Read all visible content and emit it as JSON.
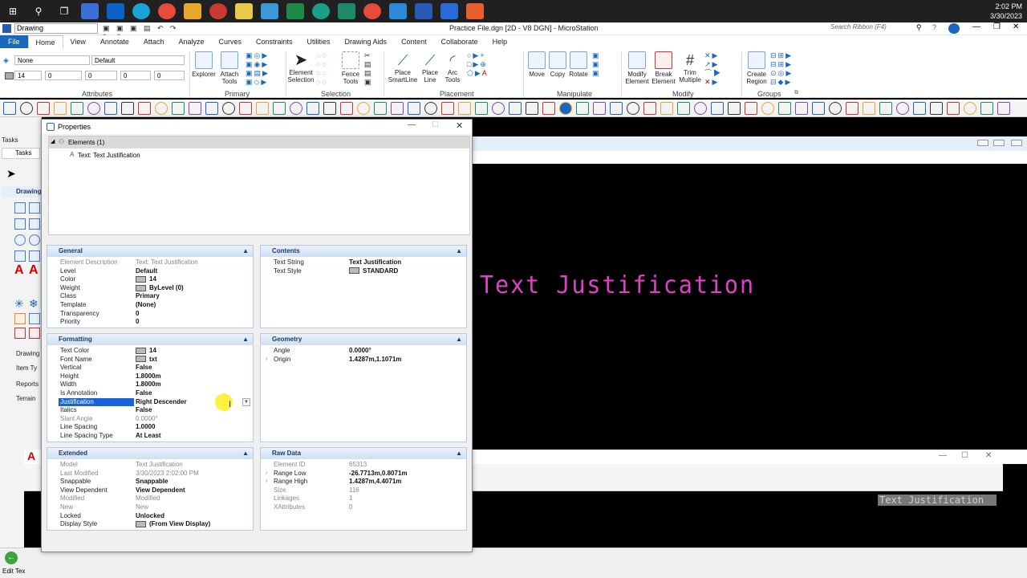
{
  "taskbar": {
    "time": "2:02 PM",
    "date": "3/30/2023"
  },
  "titlebar": {
    "workspace": "Drawing",
    "title": "Practice File.dgn [2D - V8 DGN] - MicroStation",
    "search_placeholder": "Search Ribbon (F4)"
  },
  "menu": [
    "File",
    "Home",
    "View",
    "Annotate",
    "Attach",
    "Analyze",
    "Curves",
    "Constraints",
    "Utilities",
    "Drawing Aids",
    "Content",
    "Collaborate",
    "Help"
  ],
  "ribbon": {
    "attributes": {
      "level": "None",
      "style": "Default",
      "color": "14",
      "weight": "0",
      "line": "0",
      "a": "0",
      "b": "0",
      "c": "0",
      "label": "Attributes"
    },
    "primary": {
      "explorer": "Explorer",
      "attach_tools": "Attach Tools",
      "label": "Primary"
    },
    "selection": {
      "element_selection": "Element Selection",
      "fence_tools": "Fence Tools",
      "label": "Selection"
    },
    "placement": {
      "place_smartline": "Place SmartLine",
      "place_line": "Place Line",
      "arc_tools": "Arc Tools",
      "label": "Placement"
    },
    "manipulate": {
      "move": "Move",
      "copy": "Copy",
      "rotate": "Rotate",
      "label": "Manipulate"
    },
    "modify": {
      "modify_element": "Modify Element",
      "break_element": "Break Element",
      "trim_multiple": "Trim Multiple",
      "label": "Modify"
    },
    "groups": {
      "create_region": "Create Region",
      "label": "Groups"
    }
  },
  "leftpanel": {
    "tasks": "Tasks",
    "tasks_tab": "Tasks",
    "drawing": "Drawing",
    "drawing2": "Drawing",
    "item_types": "Item Ty",
    "reports": "Reports",
    "terrain": "Terrain",
    "edit_text": "Edit Tex"
  },
  "canvas": {
    "text": "Text Justification"
  },
  "view2": {
    "text": "Text Justification"
  },
  "properties": {
    "title": "Properties",
    "tree": {
      "root": "Elements (1)",
      "child": "Text: Text Justification"
    },
    "general": {
      "title": "General",
      "rows": [
        {
          "k": "Element Description",
          "v": "Text: Text Justification",
          "dim": true
        },
        {
          "k": "Level",
          "v": "Default"
        },
        {
          "k": "Color",
          "v": "14",
          "swatch": true
        },
        {
          "k": "Weight",
          "v": "ByLevel (0)",
          "swatch": true
        },
        {
          "k": "Class",
          "v": "Primary"
        },
        {
          "k": "Template",
          "v": "(None)"
        },
        {
          "k": "Transparency",
          "v": "0"
        },
        {
          "k": "Priority",
          "v": "0"
        }
      ]
    },
    "contents": {
      "title": "Contents",
      "rows": [
        {
          "k": "Text String",
          "v": "Text Justification"
        },
        {
          "k": "Text Style",
          "v": "STANDARD",
          "swatch": true
        }
      ]
    },
    "formatting": {
      "title": "Formatting",
      "rows": [
        {
          "k": "Text Color",
          "v": "14",
          "swatch": true
        },
        {
          "k": "Font Name",
          "v": "txt",
          "swatch": true
        },
        {
          "k": "Vertical",
          "v": "False"
        },
        {
          "k": "Height",
          "v": "1.8000m"
        },
        {
          "k": "Width",
          "v": "1.8000m"
        },
        {
          "k": "Is Annotation",
          "v": "False"
        },
        {
          "k": "Justification",
          "v": "Right Descender",
          "hl": true
        },
        {
          "k": "Italics",
          "v": "False"
        },
        {
          "k": "Slant Angle",
          "v": "0.0000°",
          "dim": true
        },
        {
          "k": "Line Spacing",
          "v": "1.0000"
        },
        {
          "k": "Line Spacing Type",
          "v": "At Least"
        }
      ]
    },
    "geometry": {
      "title": "Geometry",
      "rows": [
        {
          "k": "Angle",
          "v": "0.0000°"
        },
        {
          "k": "Origin",
          "v": "1.4287m,1.1071m",
          "expand": true
        }
      ]
    },
    "extended": {
      "title": "Extended",
      "rows": [
        {
          "k": "Model",
          "v": "Text Justification",
          "dim": true
        },
        {
          "k": "Last Modified",
          "v": "3/30/2023 2:02:00 PM",
          "dim": true
        },
        {
          "k": "Snappable",
          "v": "Snappable"
        },
        {
          "k": "View Dependent",
          "v": "View Dependent"
        },
        {
          "k": "Modified",
          "v": "Modified",
          "dim": true
        },
        {
          "k": "New",
          "v": "New",
          "dim": true
        },
        {
          "k": "Locked",
          "v": "Unlocked"
        },
        {
          "k": "Display Style",
          "v": "(From View Display)",
          "swatch": true
        }
      ]
    },
    "rawdata": {
      "title": "Raw Data",
      "rows": [
        {
          "k": "Element ID",
          "v": "65313",
          "dim": true
        },
        {
          "k": "Range Low",
          "v": "-26.7713m,0.8071m",
          "expand": true
        },
        {
          "k": "Range High",
          "v": "1.4287m,4.4071m",
          "expand": true
        },
        {
          "k": "Size",
          "v": "116",
          "dim": true
        },
        {
          "k": "Linkages",
          "v": "1",
          "dim": true
        },
        {
          "k": "XAttributes",
          "v": "0",
          "dim": true
        }
      ]
    }
  }
}
